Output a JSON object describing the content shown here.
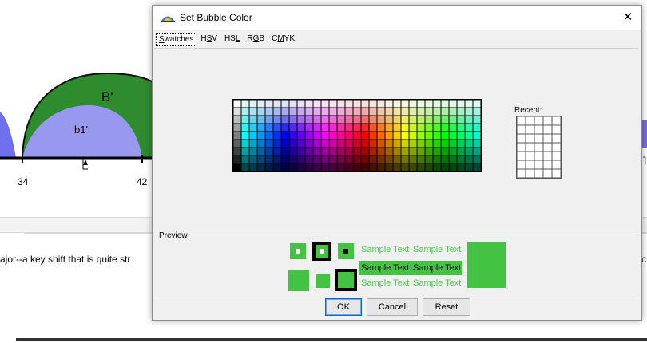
{
  "background": {
    "chart_labels": {
      "big": "B'",
      "small": "b1'"
    },
    "axis_ticks": [
      "34",
      "42"
    ],
    "body_text": "ajor--a key shift that is quite str",
    "right_edge_text": "c"
  },
  "dialog": {
    "title": "Set Bubble Color",
    "close_glyph": "✕",
    "tabs": [
      {
        "label": "Swatches",
        "mnemonic_index": 0,
        "active": true
      },
      {
        "label": "HSV",
        "mnemonic_index": 1,
        "active": false
      },
      {
        "label": "HSL",
        "mnemonic_index": 2,
        "active": false
      },
      {
        "label": "RGB",
        "mnemonic_index": 1,
        "active": false
      },
      {
        "label": "CMYK",
        "mnemonic_index": 1,
        "active": false
      }
    ],
    "recent_label": "Recent:",
    "preview": {
      "label": "Preview",
      "sample_text": "Sample Text",
      "color": "#44c244"
    },
    "buttons": {
      "ok": "OK",
      "cancel": "Cancel",
      "reset": "Reset"
    }
  },
  "colors": {
    "accent_shape": "#2e8b2e",
    "light_shape": "#9898f0",
    "selection": "#44c244"
  }
}
